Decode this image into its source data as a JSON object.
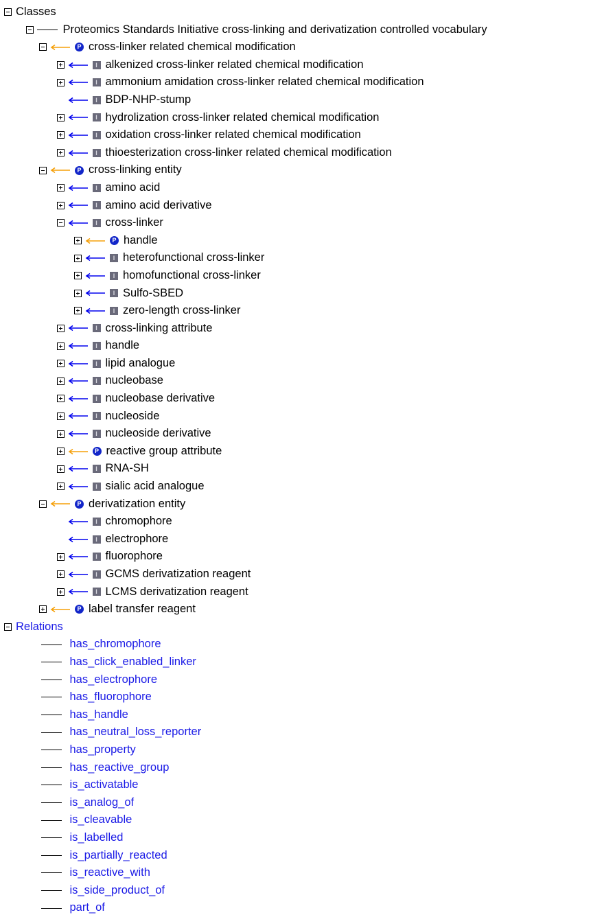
{
  "tree": {
    "classes_label": "Classes",
    "root": {
      "label": "Proteomics Standards Initiative cross-linking and derivatization controlled vocabulary",
      "expanded": true,
      "children": [
        {
          "label": "cross-linker related chemical modification",
          "icon": "P",
          "arrow": "orange",
          "toggle": "minus",
          "children": [
            {
              "label": "alkenized cross-linker related chemical modification",
              "icon": "I",
              "arrow": "blue",
              "toggle": "plus"
            },
            {
              "label": "ammonium amidation cross-linker related chemical modification",
              "icon": "I",
              "arrow": "blue",
              "toggle": "plus"
            },
            {
              "label": "BDP-NHP-stump",
              "icon": "I",
              "arrow": "blue",
              "toggle": "none"
            },
            {
              "label": "hydrolization cross-linker related chemical modification",
              "icon": "I",
              "arrow": "blue",
              "toggle": "plus"
            },
            {
              "label": "oxidation cross-linker related chemical modification",
              "icon": "I",
              "arrow": "blue",
              "toggle": "plus"
            },
            {
              "label": "thioesterization cross-linker related chemical modification",
              "icon": "I",
              "arrow": "blue",
              "toggle": "plus"
            }
          ]
        },
        {
          "label": "cross-linking entity",
          "icon": "P",
          "arrow": "orange",
          "toggle": "minus",
          "children": [
            {
              "label": "amino acid",
              "icon": "I",
              "arrow": "blue",
              "toggle": "plus"
            },
            {
              "label": "amino acid derivative",
              "icon": "I",
              "arrow": "blue",
              "toggle": "plus"
            },
            {
              "label": "cross-linker",
              "icon": "I",
              "arrow": "blue",
              "toggle": "minus",
              "children": [
                {
                  "label": "handle",
                  "icon": "P",
                  "arrow": "orange",
                  "toggle": "plus"
                },
                {
                  "label": "heterofunctional cross-linker",
                  "icon": "I",
                  "arrow": "blue",
                  "toggle": "plus"
                },
                {
                  "label": "homofunctional cross-linker",
                  "icon": "I",
                  "arrow": "blue",
                  "toggle": "plus"
                },
                {
                  "label": "Sulfo-SBED",
                  "icon": "I",
                  "arrow": "blue",
                  "toggle": "plus"
                },
                {
                  "label": "zero-length cross-linker",
                  "icon": "I",
                  "arrow": "blue",
                  "toggle": "plus"
                }
              ]
            },
            {
              "label": "cross-linking attribute",
              "icon": "I",
              "arrow": "blue",
              "toggle": "plus"
            },
            {
              "label": "handle",
              "icon": "I",
              "arrow": "blue",
              "toggle": "plus"
            },
            {
              "label": "lipid analogue",
              "icon": "I",
              "arrow": "blue",
              "toggle": "plus"
            },
            {
              "label": "nucleobase",
              "icon": "I",
              "arrow": "blue",
              "toggle": "plus"
            },
            {
              "label": "nucleobase derivative",
              "icon": "I",
              "arrow": "blue",
              "toggle": "plus"
            },
            {
              "label": "nucleoside",
              "icon": "I",
              "arrow": "blue",
              "toggle": "plus"
            },
            {
              "label": "nucleoside derivative",
              "icon": "I",
              "arrow": "blue",
              "toggle": "plus"
            },
            {
              "label": "reactive group attribute",
              "icon": "P",
              "arrow": "orange",
              "toggle": "plus"
            },
            {
              "label": "RNA-SH",
              "icon": "I",
              "arrow": "blue",
              "toggle": "plus"
            },
            {
              "label": "sialic acid analogue",
              "icon": "I",
              "arrow": "blue",
              "toggle": "plus"
            }
          ]
        },
        {
          "label": "derivatization entity",
          "icon": "P",
          "arrow": "orange",
          "toggle": "minus",
          "children": [
            {
              "label": "chromophore",
              "icon": "I",
              "arrow": "blue",
              "toggle": "none"
            },
            {
              "label": "electrophore",
              "icon": "I",
              "arrow": "blue",
              "toggle": "none"
            },
            {
              "label": "fluorophore",
              "icon": "I",
              "arrow": "blue",
              "toggle": "plus"
            },
            {
              "label": "GCMS derivatization reagent",
              "icon": "I",
              "arrow": "blue",
              "toggle": "plus"
            },
            {
              "label": "LCMS derivatization reagent",
              "icon": "I",
              "arrow": "blue",
              "toggle": "plus"
            }
          ]
        },
        {
          "label": "label transfer reagent",
          "icon": "P",
          "arrow": "orange",
          "toggle": "plus"
        }
      ]
    },
    "relations_label": "Relations",
    "relations": [
      "has_chromophore",
      "has_click_enabled_linker",
      "has_electrophore",
      "has_fluorophore",
      "has_handle",
      "has_neutral_loss_reporter",
      "has_property",
      "has_reactive_group",
      "is_activatable",
      "is_analog_of",
      "is_cleavable",
      "is_labelled",
      "is_partially_reacted",
      "is_reactive_with",
      "is_side_product_of",
      "part_of"
    ]
  },
  "colors": {
    "orange_arrow": "#f5a00a",
    "blue_arrow": "#0000ee",
    "p_icon": "#1226c9",
    "i_icon": "#6a6a7a",
    "relation_text": "#1a1ae6"
  },
  "icons": {
    "P": "property-class-icon",
    "I": "instance-class-icon",
    "orange": "orange-arrow-icon",
    "blue": "blue-arrow-icon"
  }
}
